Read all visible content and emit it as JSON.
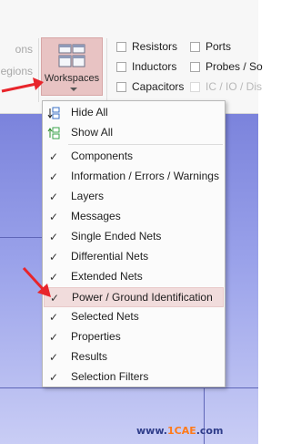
{
  "ribbon": {
    "left_items": [
      "ons",
      "egions"
    ],
    "workspaces": {
      "label": "Workspaces"
    },
    "checkboxes": [
      {
        "label": "Resistors",
        "checked": false,
        "disabled": false
      },
      {
        "label": "Ports",
        "checked": false,
        "disabled": false
      },
      {
        "label": "Inductors",
        "checked": false,
        "disabled": false
      },
      {
        "label": "Probes / So",
        "checked": false,
        "disabled": false
      },
      {
        "label": "Capacitors",
        "checked": false,
        "disabled": false
      },
      {
        "label": "IC / IO / Dis",
        "checked": false,
        "disabled": true
      }
    ]
  },
  "menu": {
    "items": [
      {
        "label": "Hide All",
        "icon": "hide-all-icon"
      },
      {
        "label": "Show All",
        "icon": "show-all-icon"
      },
      {
        "label": "Components",
        "checked": true
      },
      {
        "label": "Information / Errors / Warnings",
        "checked": true
      },
      {
        "label": "Layers",
        "checked": true
      },
      {
        "label": "Messages",
        "checked": true
      },
      {
        "label": "Single Ended Nets",
        "checked": true
      },
      {
        "label": "Differential Nets",
        "checked": true
      },
      {
        "label": "Extended Nets",
        "checked": true
      },
      {
        "label": "Power / Ground Identification",
        "checked": true,
        "highlighted": true
      },
      {
        "label": "Selected Nets",
        "checked": true
      },
      {
        "label": "Properties",
        "checked": true
      },
      {
        "label": "Results",
        "checked": true
      },
      {
        "label": "Selection Filters",
        "checked": true
      }
    ]
  },
  "watermark": {
    "prefix": "www.",
    "c": "1CAE",
    "suffix": ".com"
  },
  "colors": {
    "highlight": "#f1dcdc",
    "button_active": "#e8c3c3",
    "arrow": "#e8252b",
    "canvas": "#8e96e6"
  }
}
